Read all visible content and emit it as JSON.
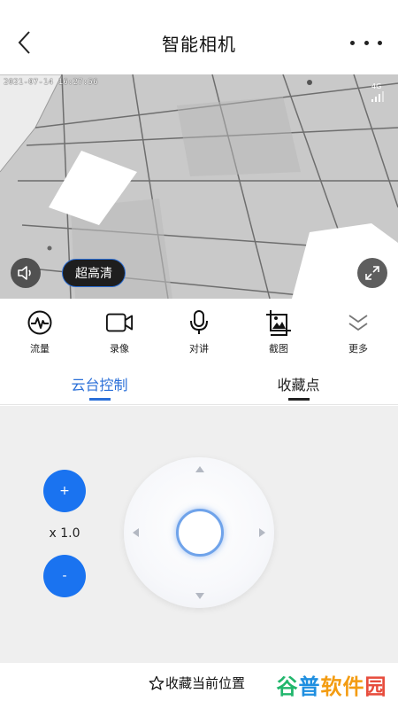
{
  "header": {
    "title": "智能相机",
    "back_icon": "chevron-left-icon",
    "more_icon": "more-horizontal-icon"
  },
  "video": {
    "timestamp": "2021-07-14 16:27:56",
    "network_label": "4G",
    "signal_level": 3,
    "quality_label": "超高清",
    "volume_icon": "speaker-icon",
    "fullscreen_icon": "expand-icon"
  },
  "toolbar": {
    "items": [
      {
        "label": "流量",
        "icon": "traffic-wave-icon"
      },
      {
        "label": "录像",
        "icon": "video-camera-icon"
      },
      {
        "label": "对讲",
        "icon": "microphone-icon"
      },
      {
        "label": "截图",
        "icon": "screenshot-image-icon"
      },
      {
        "label": "更多",
        "icon": "chevron-double-down-icon"
      }
    ]
  },
  "tabs": [
    {
      "label": "云台控制",
      "active": true
    },
    {
      "label": "收藏点",
      "active": false
    }
  ],
  "control": {
    "zoom_in_label": "+",
    "zoom_out_label": "-",
    "zoom_level": "x 1.0"
  },
  "footer": {
    "favorite_label": "收藏当前位置",
    "watermark": [
      "谷",
      "普",
      "软件",
      "园"
    ]
  },
  "colors": {
    "accent": "#2a6fd8",
    "button_blue": "#1a73f0",
    "panel_bg": "#efefef"
  }
}
